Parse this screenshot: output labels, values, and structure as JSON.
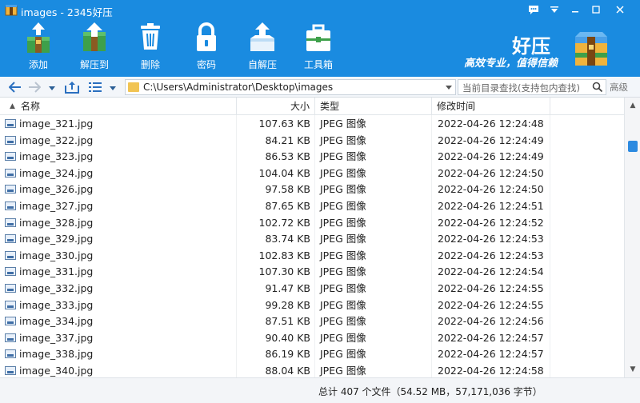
{
  "window": {
    "title": "images - 2345好压",
    "controls": [
      "chat-icon",
      "menu-icon",
      "minimize-icon",
      "maximize-icon",
      "close-icon"
    ]
  },
  "toolbar": {
    "buttons": [
      {
        "label": "添加",
        "icon": "add-archive-icon"
      },
      {
        "label": "解压到",
        "icon": "extract-to-icon"
      },
      {
        "label": "删除",
        "icon": "delete-icon"
      },
      {
        "label": "密码",
        "icon": "password-lock-icon"
      },
      {
        "label": "自解压",
        "icon": "self-extract-icon"
      },
      {
        "label": "工具箱",
        "icon": "toolbox-icon"
      }
    ]
  },
  "brand": {
    "name": "好压",
    "slogan": "高效专业，值得信赖"
  },
  "addressbar": {
    "path": "C:\\Users\\Administrator\\Desktop\\images",
    "search_placeholder": "当前目录查找(支持包内查找)",
    "advanced_label": "高级"
  },
  "columns": {
    "name": "名称",
    "size": "大小",
    "type": "类型",
    "modified": "修改时间"
  },
  "files": [
    {
      "name": "image_321.jpg",
      "size": "107.63 KB",
      "type": "JPEG 图像",
      "modified": "2022-04-26 12:24:48"
    },
    {
      "name": "image_322.jpg",
      "size": "84.21 KB",
      "type": "JPEG 图像",
      "modified": "2022-04-26 12:24:49"
    },
    {
      "name": "image_323.jpg",
      "size": "86.53 KB",
      "type": "JPEG 图像",
      "modified": "2022-04-26 12:24:49"
    },
    {
      "name": "image_324.jpg",
      "size": "104.04 KB",
      "type": "JPEG 图像",
      "modified": "2022-04-26 12:24:50"
    },
    {
      "name": "image_326.jpg",
      "size": "97.58 KB",
      "type": "JPEG 图像",
      "modified": "2022-04-26 12:24:50"
    },
    {
      "name": "image_327.jpg",
      "size": "87.65 KB",
      "type": "JPEG 图像",
      "modified": "2022-04-26 12:24:51"
    },
    {
      "name": "image_328.jpg",
      "size": "102.72 KB",
      "type": "JPEG 图像",
      "modified": "2022-04-26 12:24:52"
    },
    {
      "name": "image_329.jpg",
      "size": "83.74 KB",
      "type": "JPEG 图像",
      "modified": "2022-04-26 12:24:53"
    },
    {
      "name": "image_330.jpg",
      "size": "102.83 KB",
      "type": "JPEG 图像",
      "modified": "2022-04-26 12:24:53"
    },
    {
      "name": "image_331.jpg",
      "size": "107.30 KB",
      "type": "JPEG 图像",
      "modified": "2022-04-26 12:24:54"
    },
    {
      "name": "image_332.jpg",
      "size": "91.47 KB",
      "type": "JPEG 图像",
      "modified": "2022-04-26 12:24:55"
    },
    {
      "name": "image_333.jpg",
      "size": "99.28 KB",
      "type": "JPEG 图像",
      "modified": "2022-04-26 12:24:55"
    },
    {
      "name": "image_334.jpg",
      "size": "87.51 KB",
      "type": "JPEG 图像",
      "modified": "2022-04-26 12:24:56"
    },
    {
      "name": "image_337.jpg",
      "size": "90.40 KB",
      "type": "JPEG 图像",
      "modified": "2022-04-26 12:24:57"
    },
    {
      "name": "image_338.jpg",
      "size": "86.19 KB",
      "type": "JPEG 图像",
      "modified": "2022-04-26 12:24:57"
    },
    {
      "name": "image_340.jpg",
      "size": "88.04 KB",
      "type": "JPEG 图像",
      "modified": "2022-04-26 12:24:58"
    }
  ],
  "status": {
    "text": "总计 407 个文件（54.52 MB，57,171,036 字节）"
  },
  "colors": {
    "header_blue": "#1a8be0",
    "accent": "#2c8ae0"
  }
}
